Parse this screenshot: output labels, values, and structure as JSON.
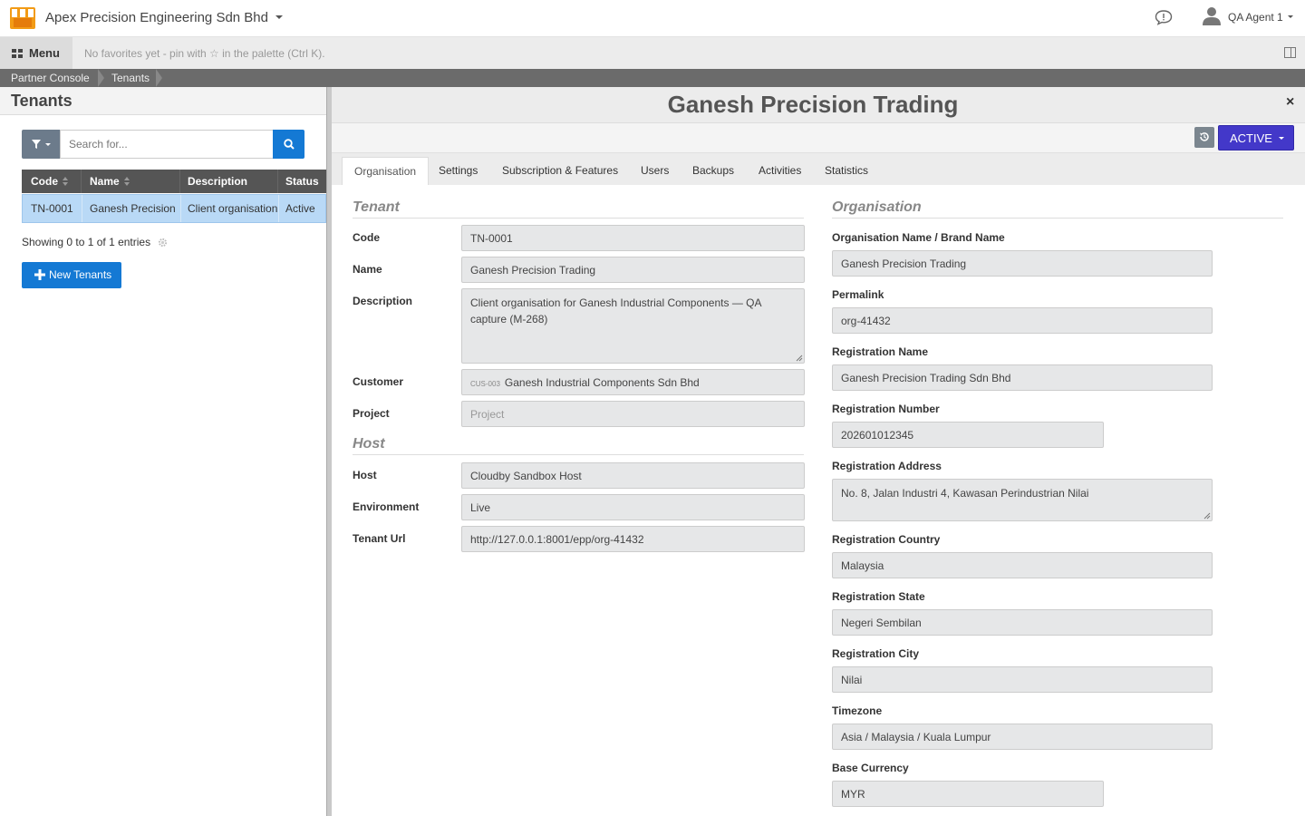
{
  "topbar": {
    "company": "Apex Precision Engineering Sdn Bhd",
    "user_name": "QA Agent 1"
  },
  "menubar": {
    "menu_label": "Menu",
    "favorites_hint": "No favorites yet - pin with ☆ in the palette (Ctrl K)."
  },
  "breadcrumb": [
    "Partner Console",
    "Tenants"
  ],
  "list": {
    "title": "Tenants",
    "search_placeholder": "Search for...",
    "columns": [
      "Code",
      "Name",
      "Description",
      "Status"
    ],
    "rows": [
      {
        "code": "TN-0001",
        "name": "Ganesh Precision Trading",
        "description": "Client organisation for Ganesh Industrial Components",
        "status": "Active"
      }
    ],
    "showing": "Showing 0 to 1 of 1 entries",
    "new_button": "New Tenants"
  },
  "record": {
    "title": "Ganesh Precision Trading",
    "close": "×",
    "status_button": "ACTIVE",
    "tabs": [
      "Organisation",
      "Settings",
      "Subscription & Features",
      "Users",
      "Backups",
      "Activities",
      "Statistics"
    ],
    "active_tab": "Organisation"
  },
  "tenant": {
    "section": "Tenant",
    "code_label": "Code",
    "code": "TN-0001",
    "name_label": "Name",
    "name": "Ganesh Precision Trading",
    "description_label": "Description",
    "description": "Client organisation for Ganesh Industrial Components — QA capture (M-268)",
    "customer_label": "Customer",
    "customer_code": "CUS-003",
    "customer": "Ganesh Industrial Components Sdn Bhd",
    "project_label": "Project",
    "project_placeholder": "Project"
  },
  "host": {
    "section": "Host",
    "host_label": "Host",
    "host": "Cloudby Sandbox Host",
    "environment_label": "Environment",
    "environment": "Live",
    "url_label": "Tenant Url",
    "url": "http://127.0.0.1:8001/epp/org-41432"
  },
  "organisation": {
    "section": "Organisation",
    "org_name_label": "Organisation Name / Brand Name",
    "org_name": "Ganesh Precision Trading",
    "permalink_label": "Permalink",
    "permalink": "org-41432",
    "reg_name_label": "Registration Name",
    "reg_name": "Ganesh Precision Trading Sdn Bhd",
    "reg_number_label": "Registration Number",
    "reg_number": "202601012345",
    "reg_address_label": "Registration Address",
    "reg_address": "No. 8, Jalan Industri 4, Kawasan Perindustrian Nilai",
    "reg_country_label": "Registration Country",
    "reg_country": "Malaysia",
    "reg_state_label": "Registration State",
    "reg_state": "Negeri Sembilan",
    "reg_city_label": "Registration City",
    "reg_city": "Nilai",
    "timezone_label": "Timezone",
    "timezone": "Asia / Malaysia / Kuala Lumpur",
    "currency_label": "Base Currency",
    "currency": "MYR"
  },
  "colors": {
    "primary": "#1479d4",
    "status_button": "#4338c9",
    "selected_row": "#b9d9f6"
  }
}
